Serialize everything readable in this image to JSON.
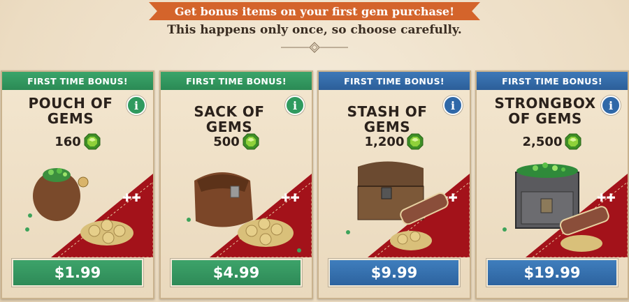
{
  "header": {
    "banner": "Get bonus items on your first gem purchase!",
    "subtitle": "This happens only once, so choose carefully."
  },
  "colors": {
    "green": "#2f9a5f",
    "blue": "#2f68a8",
    "banner_orange": "#d4642b",
    "felt_red": "#a3121a"
  },
  "cards": [
    {
      "ribbon": "FIRST TIME BONUS!",
      "title": "POUCH OF GEMS",
      "amount": "160",
      "price": "$1.99",
      "theme": "green",
      "info": "i",
      "icon": "gem-pouch-icon"
    },
    {
      "ribbon": "FIRST TIME BONUS!",
      "title": "SACK OF GEMS",
      "amount": "500",
      "price": "$4.99",
      "theme": "green",
      "info": "i",
      "icon": "gem-sack-icon"
    },
    {
      "ribbon": "FIRST TIME BONUS!",
      "title": "STASH OF GEMS",
      "amount": "1,200",
      "price": "$9.99",
      "theme": "blue",
      "info": "i",
      "icon": "gem-chest-icon"
    },
    {
      "ribbon": "FIRST TIME BONUS!",
      "title": "STRONGBOX OF GEMS",
      "amount": "2,500",
      "price": "$19.99",
      "theme": "blue",
      "info": "i",
      "icon": "gem-strongbox-icon"
    }
  ]
}
